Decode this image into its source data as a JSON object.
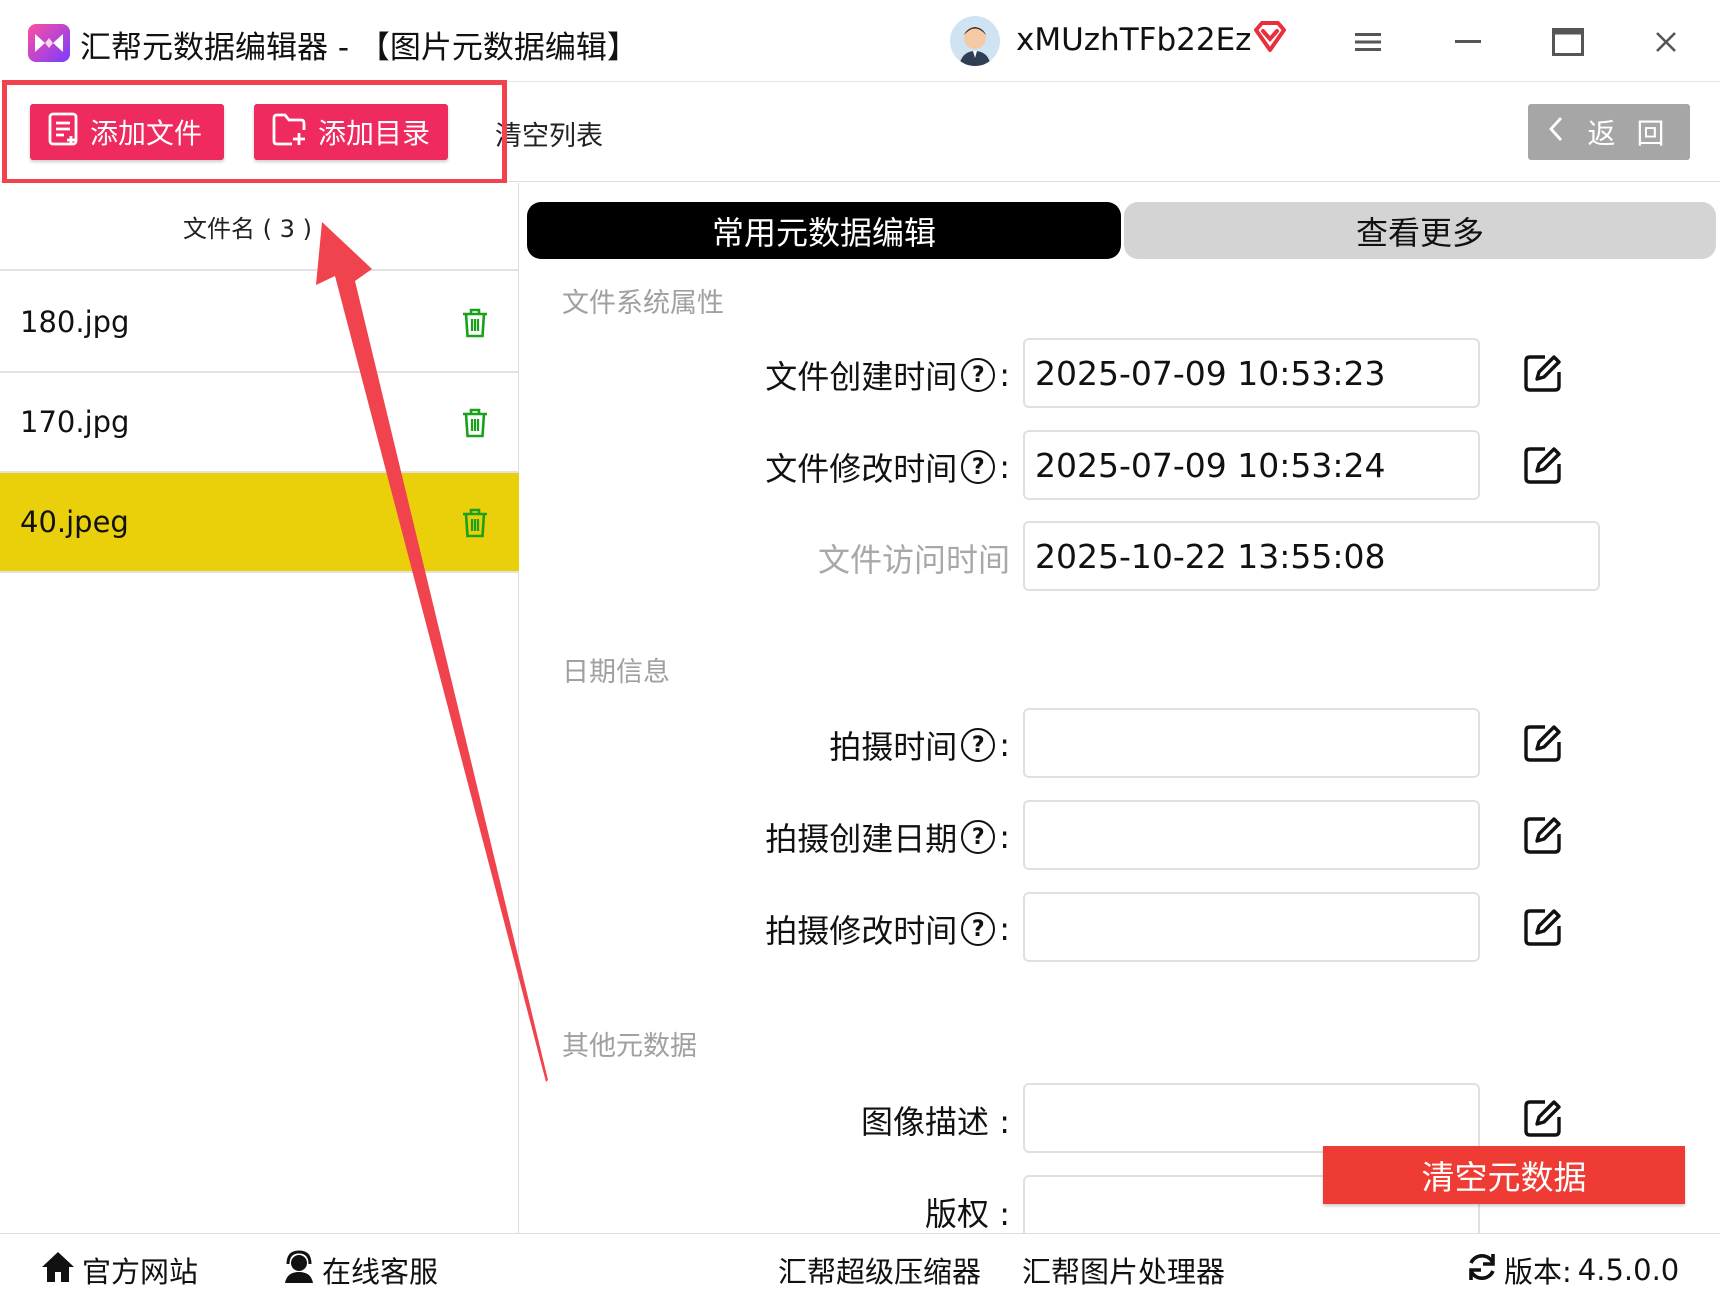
{
  "titlebar": {
    "app_name": "汇帮元数据编辑器 - 【图片元数据编辑】",
    "username": "xMUzhTFb22Ez"
  },
  "toolbar": {
    "add_file": "添加文件",
    "add_folder": "添加目录",
    "clear_list": "清空列表",
    "back": "返 回"
  },
  "file_list": {
    "header": "文件名 ( 3 )",
    "files": [
      {
        "name": "180.jpg",
        "selected": false
      },
      {
        "name": "170.jpg",
        "selected": false
      },
      {
        "name": "40.jpeg",
        "selected": true
      }
    ]
  },
  "tabs": {
    "active": "常用元数据编辑",
    "more": "查看更多"
  },
  "sections": {
    "fs": "文件系统属性",
    "date": "日期信息",
    "other": "其他元数据"
  },
  "fields": {
    "create_time": {
      "label": "文件创建时间",
      "value": "2025-07-09 10:53:23"
    },
    "modify_time": {
      "label": "文件修改时间",
      "value": "2025-07-09 10:53:24"
    },
    "access_time": {
      "label": "文件访问时间",
      "value": "2025-10-22 13:55:08"
    },
    "shot_time": {
      "label": "拍摄时间",
      "value": ""
    },
    "shot_create_date": {
      "label": "拍摄创建日期",
      "value": ""
    },
    "shot_modify_time": {
      "label": "拍摄修改时间",
      "value": ""
    },
    "image_desc": {
      "label": "图像描述 :",
      "value": ""
    },
    "copyright": {
      "label": "版权 :",
      "value": ""
    }
  },
  "qmark": "?",
  "colon": ":",
  "clear_metadata": "清空元数据",
  "statusbar": {
    "website": "官方网站",
    "support": "在线客服",
    "compressor": "汇帮超级压缩器",
    "image_tool": "汇帮图片处理器",
    "version_label": "版本:",
    "version": "4.5.0.0"
  },
  "colors": {
    "accent_pink": "#ee2a5e",
    "selected_row": "#e9d00b",
    "danger": "#ee3b33",
    "annotation": "#f0434d"
  }
}
